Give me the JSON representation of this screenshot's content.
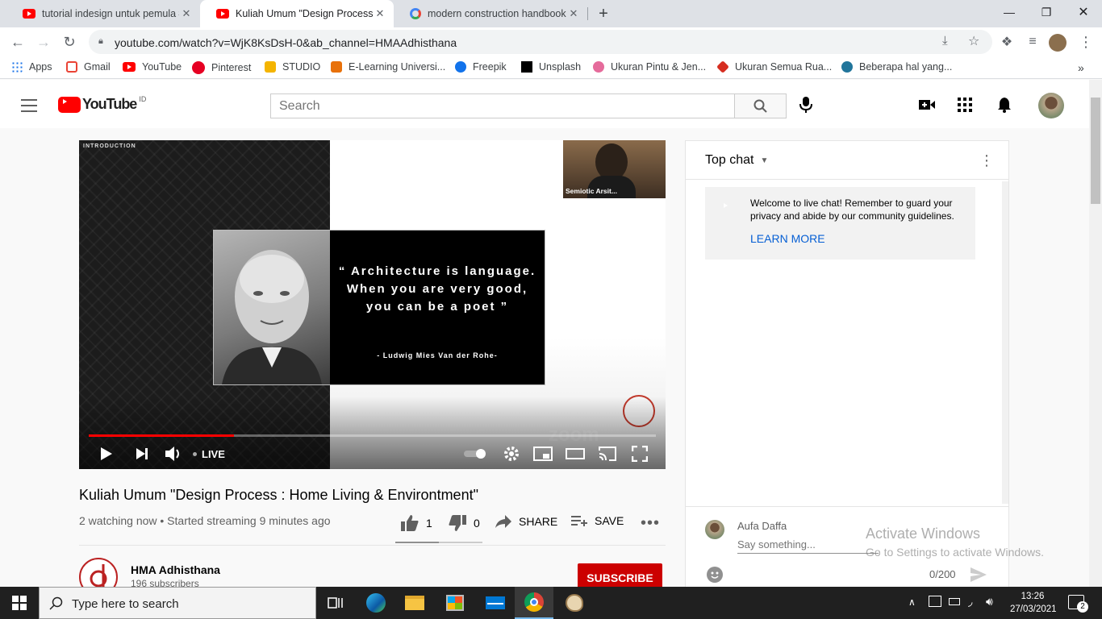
{
  "browser": {
    "tabs": [
      {
        "title": "tutorial indesign untuk pemula #",
        "active": false
      },
      {
        "title": "Kuliah Umum \"Design Process : H",
        "active": true
      },
      {
        "title": "modern construction handbook -",
        "active": false
      }
    ],
    "url": "youtube.com/watch?v=WjK8KsDsH-0&ab_channel=HMAAdhisthana",
    "bookmarks": [
      "Apps",
      "Gmail",
      "YouTube",
      "Pinterest",
      "STUDIO",
      "E-Learning Universi...",
      "Freepik",
      "Unsplash",
      "Ukuran Pintu & Jen...",
      "Ukuran Semua Rua...",
      "Beberapa hal yang..."
    ]
  },
  "masthead": {
    "logo_text": "YouTube",
    "region": "ID",
    "search_placeholder": "Search"
  },
  "player": {
    "slide_label": "INTRODUCTION",
    "quote": "“ Architecture is language. When you are very good, you can be a poet ”",
    "quote_author": "- Ludwig Mies Van der Rohe-",
    "cam_label": "Semiotic Arsit...",
    "live_label": "LIVE",
    "progress_fraction": 0.256
  },
  "video": {
    "title": "Kuliah Umum \"Design Process : Home Living & Environtment\"",
    "meta": "2 watching now • Started streaming 9 minutes ago",
    "likes": "1",
    "dislikes": "0",
    "like_fraction": 0.5,
    "share_label": "SHARE",
    "save_label": "SAVE",
    "channel_name": "HMA Adhisthana",
    "channel_subs": "196 subscribers",
    "subscribe_label": "SUBSCRIBE"
  },
  "chat": {
    "mode_label": "Top chat",
    "welcome": "Welcome to live chat! Remember to guard your privacy and abide by our community guidelines.",
    "learn_more": "LEARN MORE",
    "user": "Aufa Daffa",
    "input_placeholder": "Say something...",
    "char_count": "0/200"
  },
  "watermark": {
    "line1": "Activate Windows",
    "line2": "Go to Settings to activate Windows."
  },
  "taskbar": {
    "search_text": "Type here to search",
    "time": "13:26",
    "date": "27/03/2021",
    "notifications": "2"
  },
  "colors": {
    "youtube_red": "#ff0000",
    "subscribe_red": "#cc0000",
    "link_blue": "#065fd4"
  }
}
